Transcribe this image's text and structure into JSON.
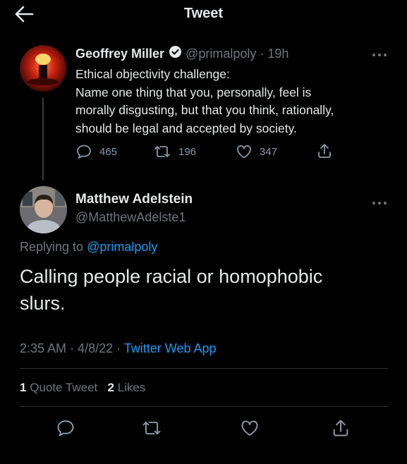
{
  "header": {
    "title": "Tweet"
  },
  "parent_tweet": {
    "name": "Geoffrey Miller",
    "handle": "@primalpoly",
    "time": "19h",
    "lines": [
      "Ethical objectivity challenge:",
      "Name one thing that you, personally, feel is",
      "morally disgusting, but that you think, rationally,",
      "should be legal and accepted by society."
    ],
    "replies": "465",
    "retweets": "196",
    "likes": "347"
  },
  "reply_tweet": {
    "name": "Matthew Adelstein",
    "handle": "@MatthewAdelste1",
    "replying_prefix": "Replying to ",
    "replying_to": "@primalpoly",
    "lines": [
      "Calling people racial or homophobic",
      "slurs."
    ],
    "time": "2:35 AM",
    "date": "4/8/22",
    "source": "Twitter Web App",
    "quote_count": "1",
    "quote_label": "Quote Tweet",
    "likes_count": "2",
    "likes_label": "Likes"
  },
  "colors": {
    "accent": "#1d9bf0",
    "background": "#000000",
    "muted": "#71767b"
  }
}
